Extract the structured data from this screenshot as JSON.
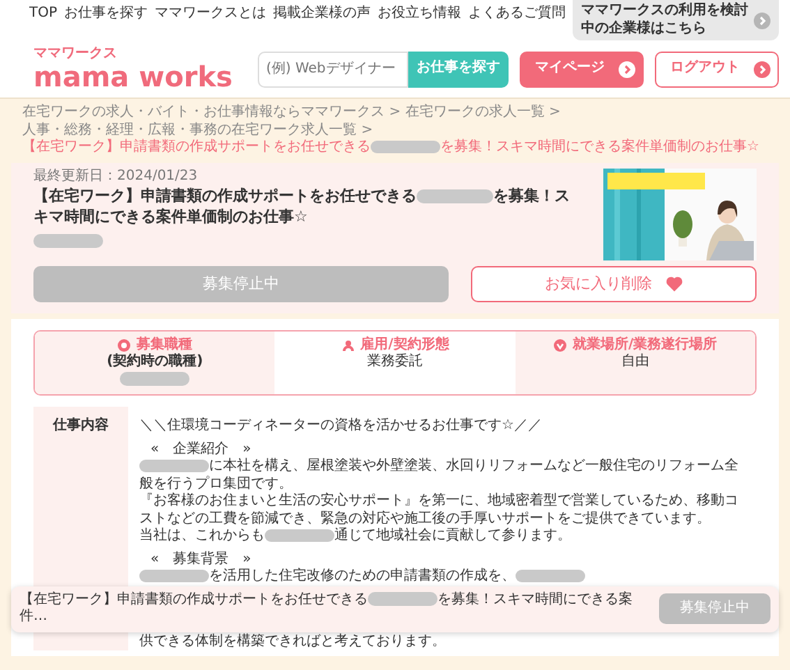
{
  "header": {
    "logo": {
      "kana": "ママワークス",
      "name": "mama works"
    },
    "nav": [
      "TOP",
      "お仕事を探す",
      "ママワークスとは",
      "掲載企業様の声",
      "お役立ち情報",
      "よくあるご質問"
    ],
    "company_link": "ママワークスの利用を検討中の企業様はこちら",
    "search": {
      "placeholder": "(例) Webデザイナー",
      "button": "お仕事を探す"
    },
    "mypage_button": "マイページ",
    "logout_button": "ログアウト"
  },
  "breadcrumb": {
    "separator": ">",
    "items": [
      {
        "current": false,
        "segments": [
          {
            "kind": "text",
            "text": "在宅ワークの求人・バイト・お仕事情報ならママワークス"
          }
        ]
      },
      {
        "current": false,
        "segments": [
          {
            "kind": "text",
            "text": "在宅ワークの求人一覧"
          }
        ]
      },
      {
        "current": false,
        "segments": [
          {
            "kind": "text",
            "text": "人事・総務・経理・広報・事務の在宅ワーク求人一覧"
          }
        ]
      },
      {
        "current": true,
        "segments": [
          {
            "kind": "text",
            "text": "【在宅ワーク】申請書類の作成サポートをお任せできる"
          },
          {
            "kind": "redacted"
          },
          {
            "kind": "text",
            "text": "を募集！スキマ時間にできる案件単価制のお仕事☆"
          }
        ]
      }
    ]
  },
  "job": {
    "updated": "最終更新日：2024/01/23",
    "title": [
      {
        "kind": "text",
        "text": "【在宅ワーク】申請書類の作成サポートをお任せできる"
      },
      {
        "kind": "redacted"
      },
      {
        "kind": "text",
        "text": "を募集！スキマ時間にできる案件単価制のお仕事☆"
      }
    ],
    "company": [
      {
        "kind": "redacted"
      }
    ],
    "status_button": {
      "label": "募集停止中",
      "disabled": true
    },
    "favorite_button": {
      "label": "お気に入り削除",
      "favorited": true
    }
  },
  "info": [
    {
      "label": "募集職種",
      "value": "(契約時の職種)",
      "note": [
        {
          "kind": "redacted"
        }
      ]
    },
    {
      "label": "雇用/契約形態",
      "value": "業務委託"
    },
    {
      "label": "就業場所/業務遂行場所",
      "value": "自由"
    }
  ],
  "description": {
    "label": "仕事内容",
    "blocks": [
      {
        "kind": "paragraph",
        "segments": [
          {
            "kind": "text",
            "text": "＼＼住環境コーディネーターの資格を活かせるお仕事です☆／／"
          }
        ]
      },
      {
        "kind": "blank"
      },
      {
        "kind": "heading",
        "segments": [
          {
            "kind": "text",
            "text": "«　企業紹介　»"
          }
        ]
      },
      {
        "kind": "paragraph",
        "segments": [
          {
            "kind": "redacted"
          },
          {
            "kind": "text",
            "text": "に本社を構え、屋根塗装や外壁塗装、水回りリフォームなど一般住宅のリフォーム全般を行うプロ集団です。"
          }
        ]
      },
      {
        "kind": "paragraph",
        "segments": [
          {
            "kind": "text",
            "text": "『お客様のお住まいと生活の安心サポート』を第一に、地域密着型で営業しているため、移動コストなどの工費を節減でき、緊急の対応や施工後の手厚いサポートをご提供できています。"
          }
        ]
      },
      {
        "kind": "paragraph",
        "segments": [
          {
            "kind": "text",
            "text": "当社は、これからも"
          },
          {
            "kind": "redacted"
          },
          {
            "kind": "text",
            "text": "通じて地域社会に貢献して参ります。"
          }
        ]
      },
      {
        "kind": "blank"
      },
      {
        "kind": "heading",
        "segments": [
          {
            "kind": "text",
            "text": "«　募集背景　»"
          }
        ]
      },
      {
        "kind": "paragraph",
        "segments": [
          {
            "kind": "redacted"
          },
          {
            "kind": "text",
            "text": "を活用した住宅改修のための申請書類の作成を、"
          },
          {
            "kind": "redacted"
          }
        ]
      },
      {
        "kind": "paragraph",
        "segments": [
          {
            "kind": "text",
            "text": "供できる体制を構築できればと考えております。"
          }
        ]
      }
    ]
  },
  "sticky_bar": {
    "segments": [
      {
        "kind": "text",
        "text": "【在宅ワーク】申請書類の作成サポートをお任せできる"
      },
      {
        "kind": "redacted"
      },
      {
        "kind": "text",
        "text": "を募集！スキマ時間にできる案件…"
      }
    ],
    "button": {
      "label": "募集停止中",
      "disabled": true
    }
  }
}
